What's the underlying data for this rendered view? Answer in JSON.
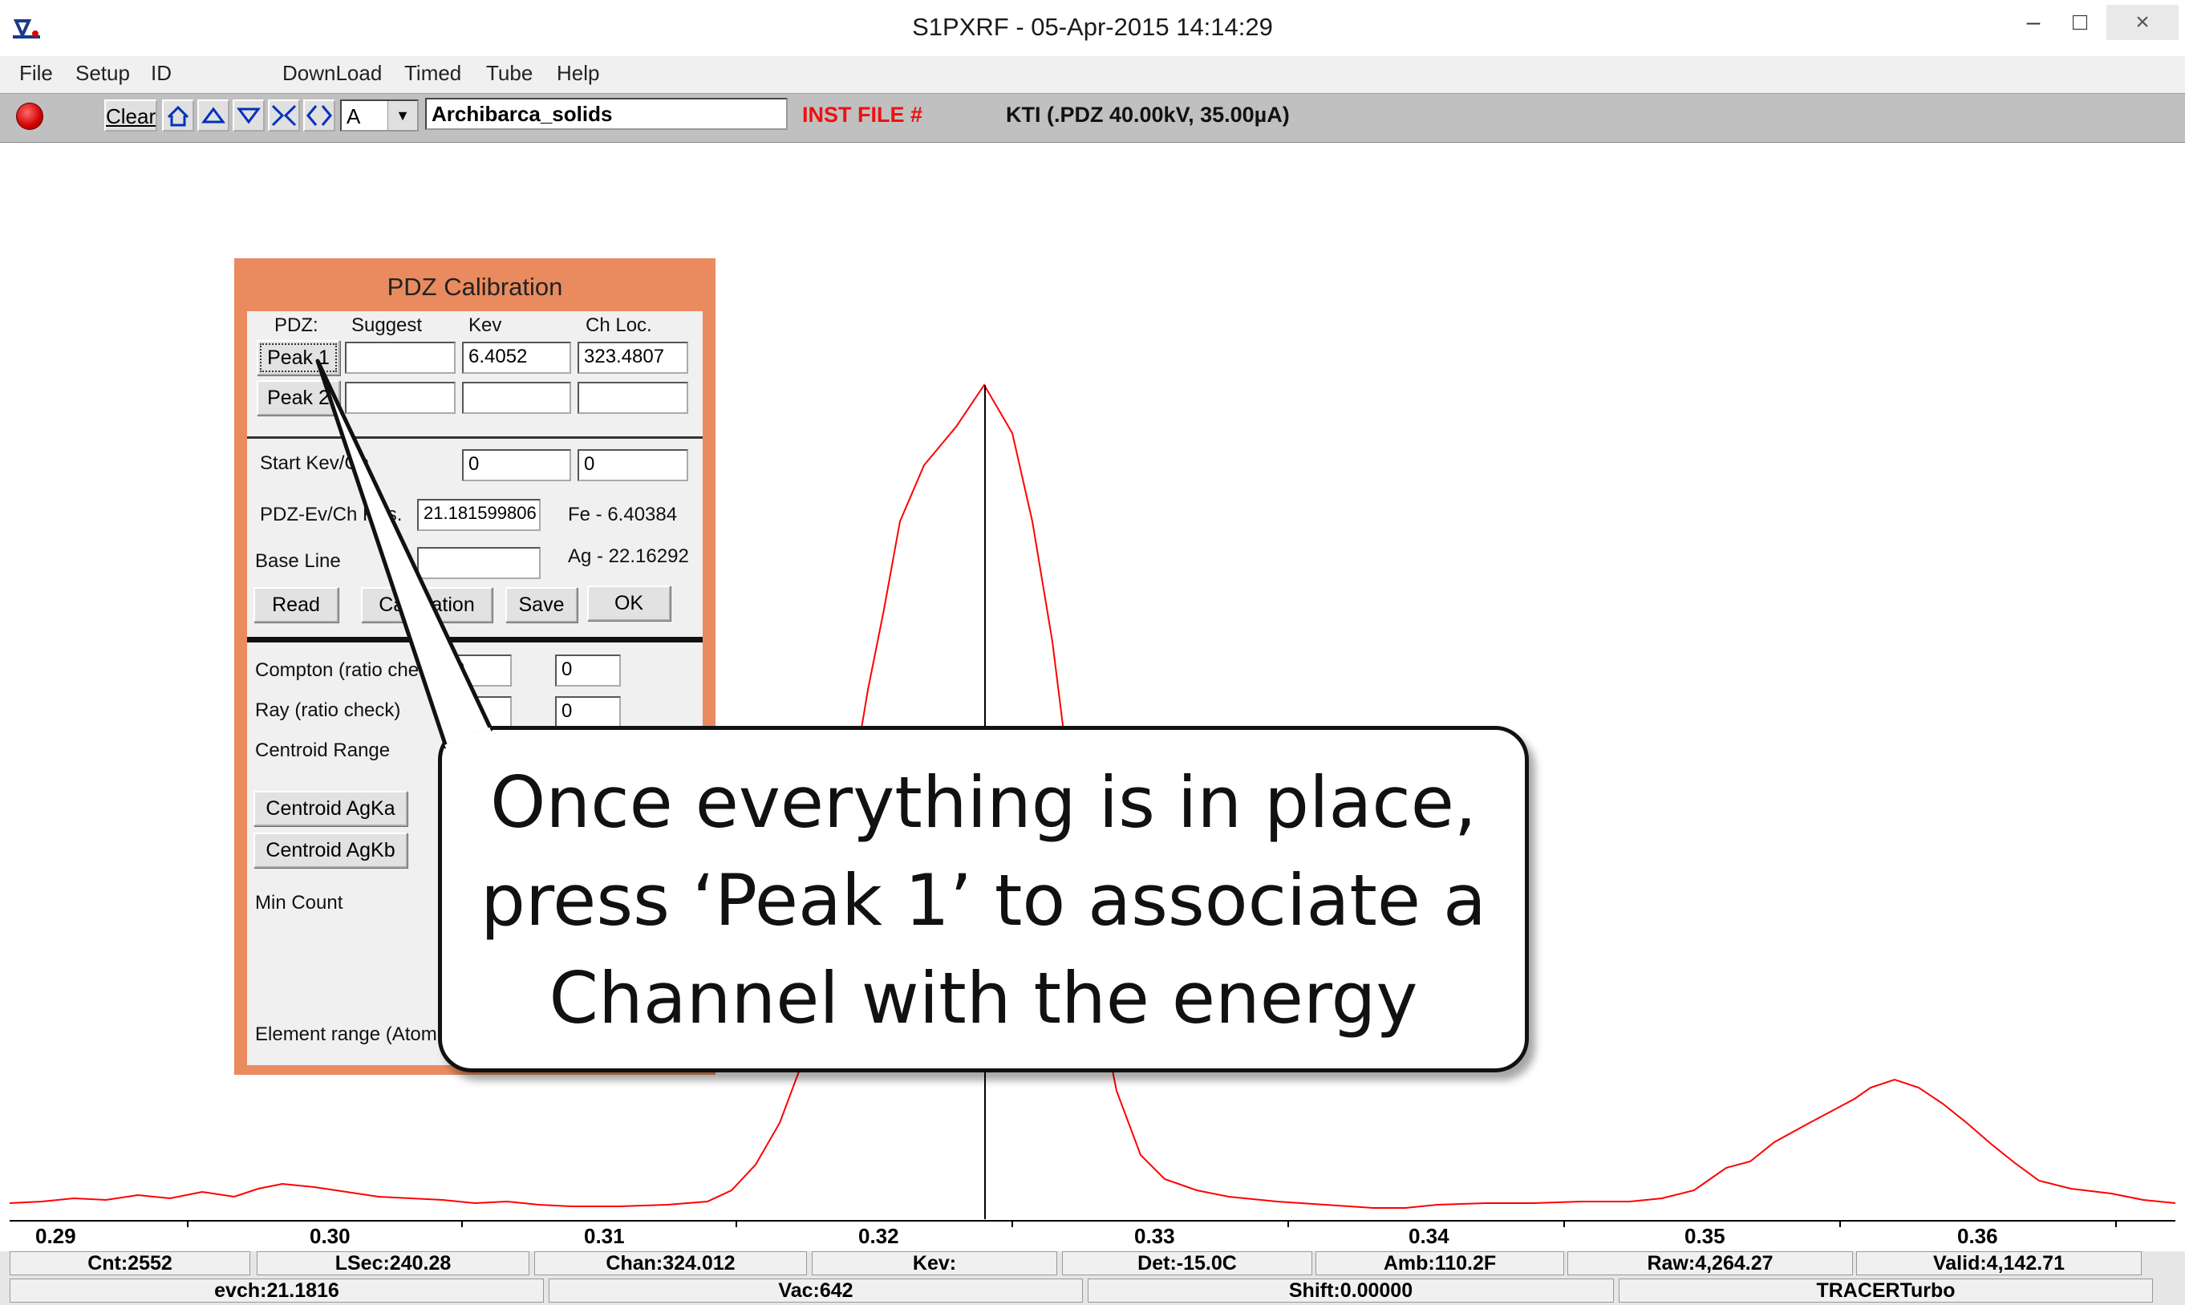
{
  "window": {
    "title": "S1PXRF - 05-Apr-2015 14:14:29",
    "minimize_glyph": "–",
    "maximize_glyph": "□",
    "close_glyph": "×"
  },
  "menu": [
    "File",
    "Setup",
    "ID",
    "DownLoad",
    "Timed",
    "Tube",
    "Help"
  ],
  "toolbar": {
    "clear_label": "Clear",
    "combo_value": "A",
    "sample_name": "Archibarca_solids",
    "inst_file_label": "INST FILE #",
    "kti_label": "KTI  (.PDZ 40.00kV, 35.00µA)",
    "colors": {
      "inst_file": "#ee1111"
    }
  },
  "plot": {
    "x_ticks": [
      "0.29",
      "0.30",
      "0.31",
      "0.32",
      "0.33",
      "0.34",
      "0.35",
      "0.36"
    ],
    "line_color": "#ff0000"
  },
  "status": {
    "row1": [
      "Cnt:2552",
      "LSec:240.28",
      "Chan:324.012",
      "Kev:",
      "Det:-15.0C",
      "Amb:110.2F",
      "Raw:4,264.27",
      "Valid:4,142.71"
    ],
    "row2": [
      "evch:21.1816",
      "Vac:642",
      "Shift:0.00000",
      "TRACERTurbo"
    ]
  },
  "dialog": {
    "title": "PDZ Calibration",
    "headers": {
      "pdz": "PDZ:",
      "suggest": "Suggest",
      "kev": "Kev",
      "chloc": "Ch Loc."
    },
    "peak1_label": "Peak 1",
    "peak2_label": "Peak 2",
    "peak1": {
      "suggest": "",
      "kev": "6.4052",
      "chloc": "323.4807"
    },
    "peak2": {
      "suggest": "",
      "kev": "",
      "chloc": ""
    },
    "start_label": "Start Kev/Ch",
    "start_kev": "0",
    "start_ch": "0",
    "evch_label": "PDZ-Ev/Ch Res.",
    "evch_value": "21.181599806",
    "fe_ref": "Fe - 6.40384",
    "ag_ref": "Ag - 22.16292",
    "baseline_label": "Base Line",
    "baseline_value": "",
    "read_label": "Read",
    "calibration_label": "Calibration",
    "save_label": "Save",
    "ok_label": "OK",
    "compton_label": "Compton (ratio check)",
    "compton_a": "0",
    "compton_b": "0",
    "ray_label": "Ray (ratio check)",
    "ray_a": "0",
    "ray_b": "0",
    "centroid_label": "Centroid Range",
    "centroid_agka_label": "Centroid AgKa",
    "centroid_agkb_label": "Centroid AgKb",
    "min_count_label": "Min Count",
    "element_range_label": "Element range (Atomic"
  },
  "callout": {
    "text": "Once everything is in place, press ‘Peak 1’ to associate a Channel with the energy"
  }
}
